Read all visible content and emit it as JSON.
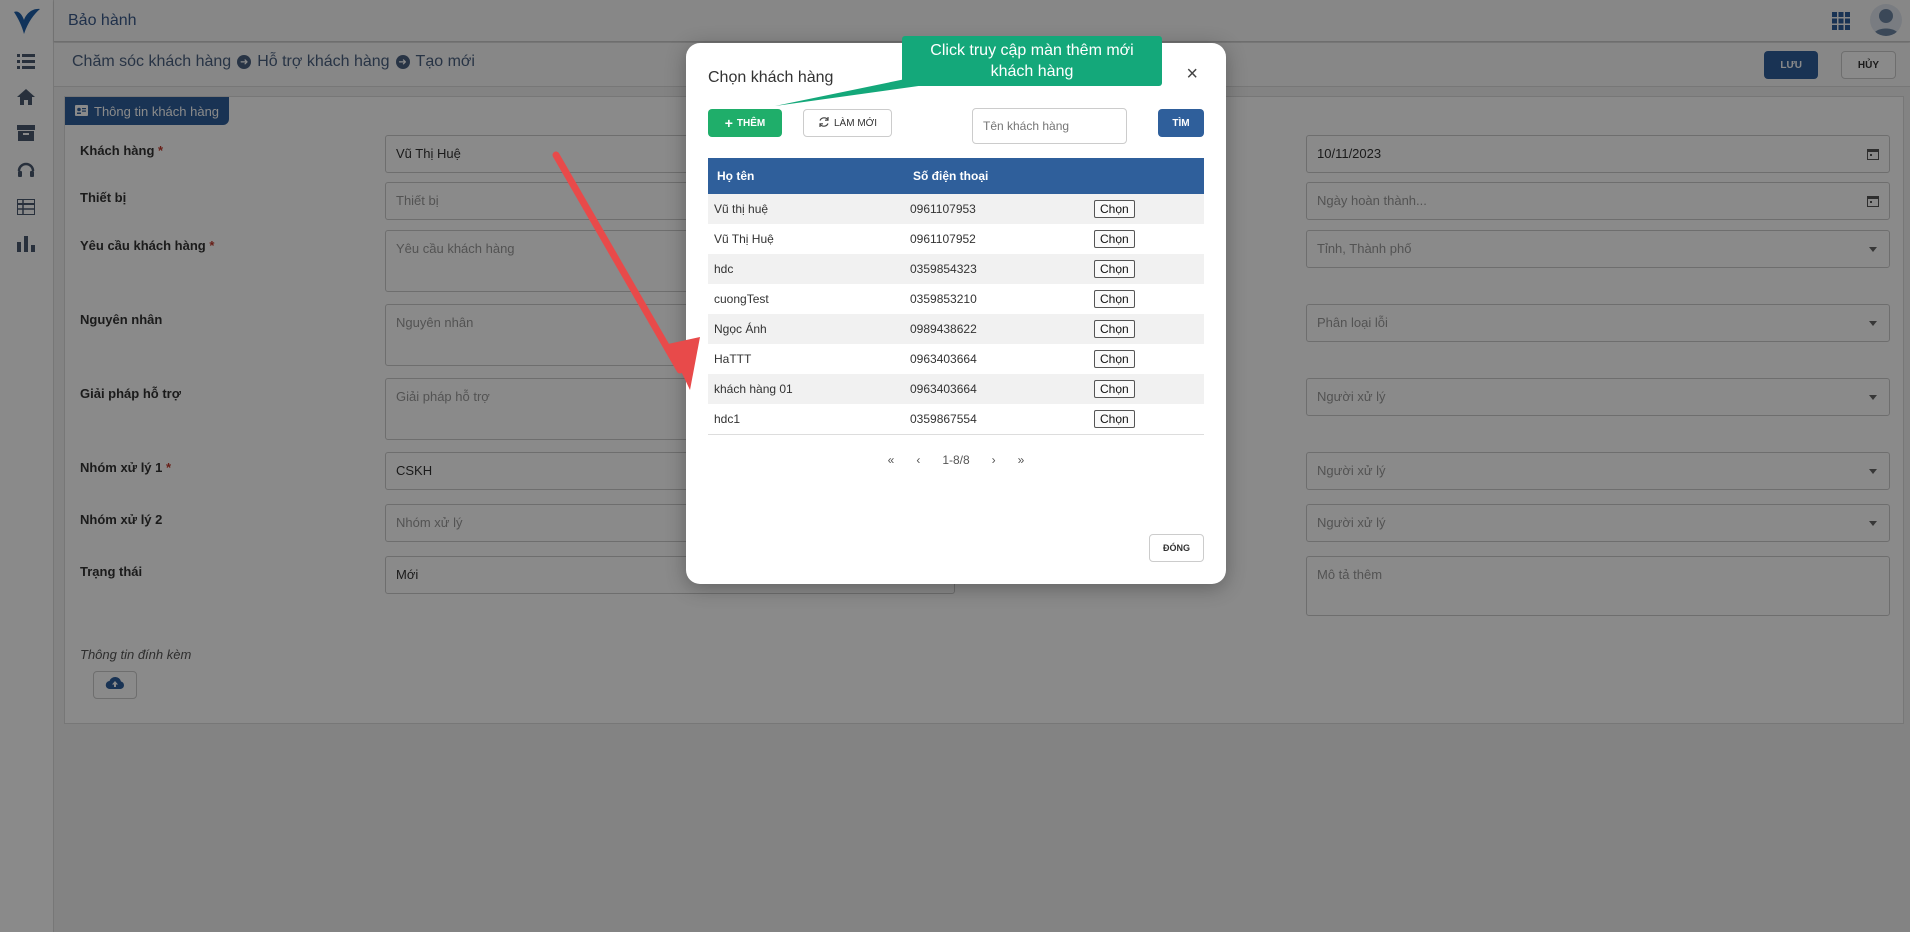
{
  "header": {
    "app_title": "Bảo hành"
  },
  "breadcrumb": {
    "items": [
      "Chăm sóc khách hàng",
      "Hỗ trợ khách hàng",
      "Tạo mới"
    ]
  },
  "toolbar": {
    "save_label": "LƯU",
    "cancel_label": "HỦY"
  },
  "section": {
    "title": "Thông tin khách hàng"
  },
  "form": {
    "customer_label": "Khách hàng",
    "customer_value": "Vũ Thị Huệ",
    "device_label": "Thiết bị",
    "device_placeholder": "Thiết bị",
    "request_label": "Yêu cầu khách hàng",
    "request_placeholder": "Yêu cầu khách hàng",
    "cause_label": "Nguyên nhân",
    "cause_placeholder": "Nguyên nhân",
    "solution_label": "Giải pháp hỗ trợ",
    "solution_placeholder": "Giải pháp hỗ trợ",
    "group1_label": "Nhóm xử lý 1",
    "group1_value": "CSKH",
    "group2_label": "Nhóm xử lý 2",
    "group2_placeholder": "Nhóm xử lý",
    "status_label": "Trạng thái",
    "status_value": "Mới",
    "date_value": "10/11/2023",
    "complete_placeholder": "Ngày hoàn thành...",
    "province_placeholder": "Tỉnh, Thành phố",
    "error_type_placeholder": "Phân loại lỗi",
    "handler1_placeholder": "Người xử lý",
    "handler2_placeholder": "Người xử lý",
    "handler3_placeholder": "Người xử lý",
    "description_placeholder": "Mô tả thêm",
    "attachment_label": "Thông tin đính kèm"
  },
  "modal": {
    "title": "Chọn khách hàng",
    "close_symbol": "×",
    "add_label": "THÊM",
    "refresh_label": "LÀM MỚI",
    "search_placeholder": "Tên khách hàng",
    "find_label": "TÌM",
    "columns": [
      "Họ tên",
      "Số điện thoại"
    ],
    "rows": [
      {
        "name": "Vũ thị huệ",
        "phone": "0961107953",
        "action": "Chọn"
      },
      {
        "name": "Vũ Thị Huệ",
        "phone": "0961107952",
        "action": "Chọn"
      },
      {
        "name": "hdc",
        "phone": "0359854323",
        "action": "Chọn"
      },
      {
        "name": "cuongTest",
        "phone": "0359853210",
        "action": "Chọn"
      },
      {
        "name": "Ngọc Ánh",
        "phone": "0989438622",
        "action": "Chọn"
      },
      {
        "name": "HaTTT",
        "phone": "0963403664",
        "action": "Chọn"
      },
      {
        "name": "khách hàng 01",
        "phone": "0963403664",
        "action": "Chọn"
      },
      {
        "name": "hdc1",
        "phone": "0359867554",
        "action": "Chọn"
      }
    ],
    "pager": {
      "first": "«",
      "prev": "‹",
      "info": "1-8/8",
      "next": "›",
      "last": "»"
    },
    "close_label": "ĐÓNG"
  },
  "tooltip": {
    "text": "Click truy cập màn thêm mới khách hàng"
  },
  "colors": {
    "primary": "#2f5f9b",
    "success": "#1fae6a",
    "tooltip": "#14a87a",
    "arrow": "#e84a4a"
  }
}
